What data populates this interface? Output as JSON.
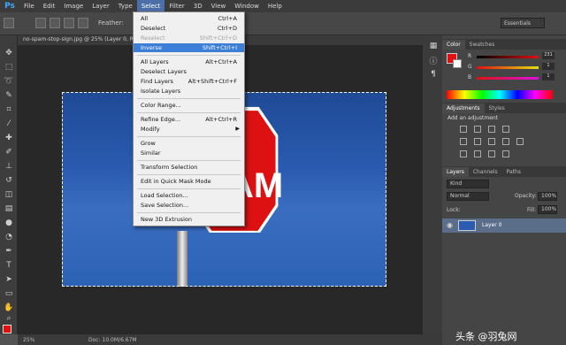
{
  "app": {
    "logo": "Ps"
  },
  "menubar": [
    "File",
    "Edit",
    "Image",
    "Layer",
    "Type",
    "Select",
    "Filter",
    "3D",
    "View",
    "Window",
    "Help"
  ],
  "options": {
    "feather_label": "Feather:",
    "workspace": "Essentials"
  },
  "document": {
    "tab_title": "no-spam-stop-sign.jpg @ 25% (Layer 0, RGB/8)",
    "sign_text": "AM"
  },
  "status": {
    "zoom": "25%",
    "doc_size": "Doc: 10.0M/6.67M"
  },
  "select_menu": {
    "groups": [
      [
        {
          "label": "All",
          "shortcut": "Ctrl+A",
          "state": "normal"
        },
        {
          "label": "Deselect",
          "shortcut": "Ctrl+D",
          "state": "normal"
        },
        {
          "label": "Reselect",
          "shortcut": "Shift+Ctrl+D",
          "state": "disabled"
        },
        {
          "label": "Inverse",
          "shortcut": "Shift+Ctrl+I",
          "state": "highlighted"
        }
      ],
      [
        {
          "label": "All Layers",
          "shortcut": "Alt+Ctrl+A",
          "state": "normal"
        },
        {
          "label": "Deselect Layers",
          "shortcut": "",
          "state": "normal"
        },
        {
          "label": "Find Layers",
          "shortcut": "Alt+Shift+Ctrl+F",
          "state": "normal"
        },
        {
          "label": "Isolate Layers",
          "shortcut": "",
          "state": "normal"
        }
      ],
      [
        {
          "label": "Color Range...",
          "shortcut": "",
          "state": "normal"
        }
      ],
      [
        {
          "label": "Refine Edge...",
          "shortcut": "Alt+Ctrl+R",
          "state": "normal"
        },
        {
          "label": "Modify",
          "shortcut": "",
          "state": "submenu"
        }
      ],
      [
        {
          "label": "Grow",
          "shortcut": "",
          "state": "normal"
        },
        {
          "label": "Similar",
          "shortcut": "",
          "state": "normal"
        }
      ],
      [
        {
          "label": "Transform Selection",
          "shortcut": "",
          "state": "normal"
        }
      ],
      [
        {
          "label": "Edit in Quick Mask Mode",
          "shortcut": "",
          "state": "normal"
        }
      ],
      [
        {
          "label": "Load Selection...",
          "shortcut": "",
          "state": "normal"
        },
        {
          "label": "Save Selection...",
          "shortcut": "",
          "state": "normal"
        }
      ],
      [
        {
          "label": "New 3D Extrusion",
          "shortcut": "",
          "state": "normal"
        }
      ]
    ]
  },
  "color_panel": {
    "tabs": [
      "Color",
      "Swatches"
    ],
    "sliders": [
      {
        "label": "R",
        "value": "231",
        "color": "#e01010"
      },
      {
        "label": "G",
        "value": "1",
        "color": "#10c010"
      },
      {
        "label": "B",
        "value": "1",
        "color": "#1010e0"
      }
    ]
  },
  "adjustments_panel": {
    "tabs": [
      "Adjustments",
      "Styles"
    ],
    "title": "Add an adjustment"
  },
  "layers_panel": {
    "tabs": [
      "Layers",
      "Channels",
      "Paths"
    ],
    "filter": "Kind",
    "blend_mode": "Normal",
    "opacity_label": "Opacity:",
    "opacity": "100%",
    "lock_label": "Lock:",
    "fill_label": "Fill:",
    "fill": "100%",
    "layer_name": "Layer 0"
  },
  "watermark": "头条 @羽兔网",
  "colors": {
    "accent": "#3d7fd6",
    "foreground": "#e01010"
  }
}
